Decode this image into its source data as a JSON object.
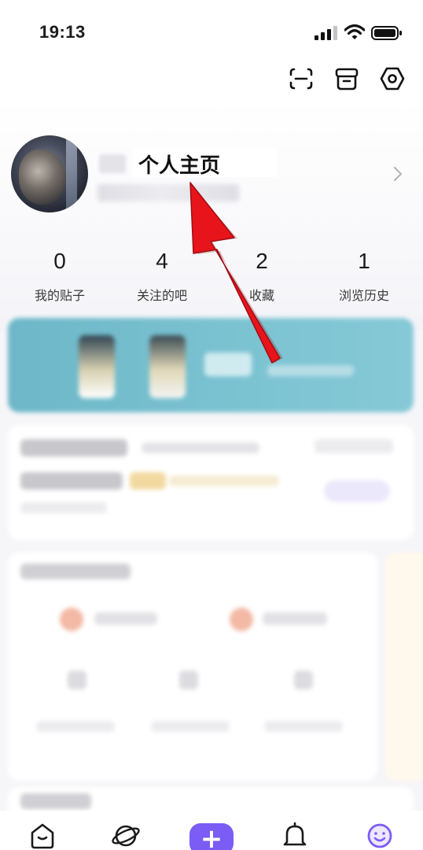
{
  "status_bar": {
    "time": "19:13",
    "icons": [
      "signal-icon",
      "wifi-icon",
      "battery-icon"
    ]
  },
  "header": {
    "icons": [
      "scan-icon",
      "box-icon",
      "settings-icon"
    ]
  },
  "profile": {
    "title": "个人主页",
    "avatar": "leopard-avatar"
  },
  "stats": [
    {
      "count": "0",
      "label": "我的贴子"
    },
    {
      "count": "4",
      "label": "关注的吧"
    },
    {
      "count": "2",
      "label": "收藏"
    },
    {
      "count": "1",
      "label": "浏览历史"
    }
  ],
  "bottom_nav": {
    "items": [
      "home-icon",
      "explore-icon",
      "add-button",
      "bell-icon",
      "me-icon"
    ],
    "add_label": "+"
  },
  "colors": {
    "accent": "#7b5cf5",
    "annotation_arrow": "#e8141c",
    "banner": "#7cc3d2"
  }
}
